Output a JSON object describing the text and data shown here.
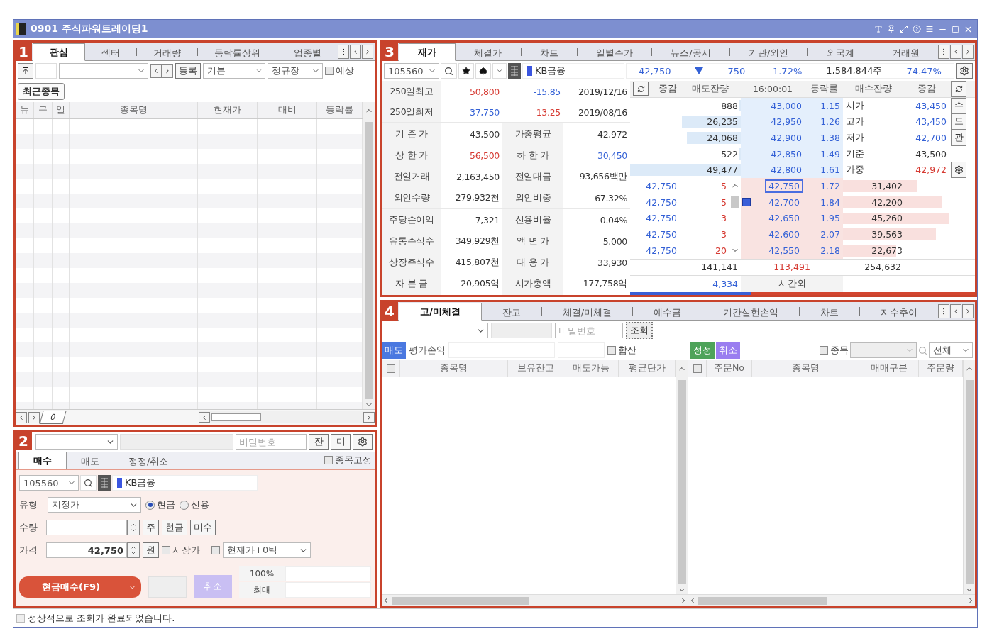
{
  "window": {
    "title": "0901 주식파워트레이딩1"
  },
  "panel1": {
    "badge": "1",
    "tabs": [
      {
        "label": "관심",
        "selected": true
      },
      {
        "label": "섹터",
        "selected": false
      },
      {
        "label": "거래량",
        "selected": false
      },
      {
        "label": "등락률상위",
        "selected": false
      },
      {
        "label": "업종별",
        "selected": false
      }
    ],
    "register_button": "등록",
    "group": "기본",
    "session": "정규장",
    "expected": {
      "label": "예상",
      "checked": false
    },
    "recent_button": "최근종목",
    "columns": [
      "뉴",
      "구",
      "일",
      "종목명",
      "현재가",
      "대비",
      "등락률"
    ],
    "sheet_tab": "0"
  },
  "panel2": {
    "badge": "2",
    "password_placeholder": "비밀번호",
    "buttons": [
      "잔",
      "미"
    ],
    "tabs": [
      {
        "label": "매수",
        "selected": true
      },
      {
        "label": "매도",
        "selected": false
      },
      {
        "label": "정정/취소",
        "selected": false
      }
    ],
    "fix_stock": {
      "label": "종목고정",
      "checked": false
    },
    "code": "105560",
    "stock_name": "KB금융",
    "type_label": "유형",
    "type_value": "지정가",
    "credit_options": [
      {
        "label": "현금",
        "selected": true
      },
      {
        "label": "신용",
        "selected": false
      }
    ],
    "qty_label": "수량",
    "qty_buttons": [
      "주",
      "현금",
      "미수"
    ],
    "price_label": "가격",
    "price_value": "42,750",
    "unit_button": "원",
    "market_price": {
      "label": "시장가",
      "checked": false
    },
    "price_mode": {
      "checked": false,
      "value": "현재가+0틱"
    },
    "order_button": "현금매수(F9)",
    "cancel_button": "취소",
    "ratio_rows": [
      "100%",
      "최대"
    ]
  },
  "panel3": {
    "badge": "3",
    "tabs": [
      {
        "label": "재가",
        "selected": true
      },
      {
        "label": "체결가",
        "selected": false
      },
      {
        "label": "차트",
        "selected": false
      },
      {
        "label": "일별주가",
        "selected": false
      },
      {
        "label": "뉴스/공시",
        "selected": false
      },
      {
        "label": "기관/외인",
        "selected": false
      },
      {
        "label": "외국계",
        "selected": false
      },
      {
        "label": "거래원",
        "selected": false
      }
    ],
    "code": "105560",
    "stock_name": "KB금융",
    "quote": {
      "price": "42,750",
      "change": "750",
      "rate": "-1.72%",
      "volume": "1,584,844주",
      "ratio": "74.47%"
    },
    "info": [
      {
        "kind": "range",
        "label": "250일최고",
        "values": [
          {
            "text": "50,800",
            "color": "#d63a32"
          },
          {
            "text": "-15.85",
            "color": "#3461d6"
          },
          {
            "text": "2019/12/16",
            "color": "#333333"
          }
        ]
      },
      {
        "kind": "range",
        "label": "250일최저",
        "values": [
          {
            "text": "37,750",
            "color": "#3461d6"
          },
          {
            "text": "13.25",
            "color": "#d63a32"
          },
          {
            "text": "2019/08/16",
            "color": "#333333"
          }
        ]
      },
      {
        "kind": "pair",
        "items": [
          {
            "label": "기 준 가",
            "value": "43,500",
            "color": "#333333"
          },
          {
            "label": "가중평균",
            "value": "42,972",
            "color": "#333333"
          }
        ]
      },
      {
        "kind": "pair",
        "items": [
          {
            "label": "상 한 가",
            "value": "56,500",
            "color": "#d63a32"
          },
          {
            "label": "하 한 가",
            "value": "30,450",
            "color": "#3461d6"
          }
        ]
      },
      {
        "kind": "pair",
        "items": [
          {
            "label": "전일거래",
            "value": "2,163,450",
            "color": "#333333"
          },
          {
            "label": "전일대금",
            "value": "93,656백만",
            "color": "#333333"
          }
        ]
      },
      {
        "kind": "pair",
        "items": [
          {
            "label": "외인수량",
            "value": "279,932천",
            "color": "#333333"
          },
          {
            "label": "외인비중",
            "value": "67.32%",
            "color": "#333333"
          }
        ]
      },
      {
        "kind": "pair",
        "items": [
          {
            "label": "주당순이익",
            "value": "7,321",
            "color": "#333333"
          },
          {
            "label": "신용비율",
            "value": "0.04%",
            "color": "#333333"
          }
        ]
      },
      {
        "kind": "pair",
        "items": [
          {
            "label": "유통주식수",
            "value": "349,929천",
            "color": "#333333"
          },
          {
            "label": "액 면 가",
            "value": "5,000",
            "color": "#333333"
          }
        ]
      },
      {
        "kind": "pair",
        "items": [
          {
            "label": "상장주식수",
            "value": "415,807천",
            "color": "#333333"
          },
          {
            "label": "대 용 가",
            "value": "33,930",
            "color": "#333333"
          }
        ]
      },
      {
        "kind": "pair",
        "items": [
          {
            "label": "자 본 금",
            "value": "20,905억",
            "color": "#333333"
          },
          {
            "label": "시가총액",
            "value": "177,758억",
            "color": "#333333"
          }
        ]
      }
    ],
    "book_header": [
      "증감",
      "매도잔량",
      "16:00:01",
      "등락률",
      "매수잔량",
      "증감"
    ],
    "asks": [
      {
        "qty": "888",
        "level": 0.02,
        "price": "43,000",
        "rate": "1.15"
      },
      {
        "qty": "26,235",
        "level": 0.53,
        "price": "42,950",
        "rate": "1.26"
      },
      {
        "qty": "24,068",
        "level": 0.49,
        "price": "42,900",
        "rate": "1.38"
      },
      {
        "qty": "522",
        "level": 0.01,
        "price": "42,850",
        "rate": "1.49"
      },
      {
        "qty": "49,477",
        "level": 1.0,
        "price": "42,800",
        "rate": "1.61"
      }
    ],
    "summary": [
      {
        "label": "시가",
        "value": "43,450",
        "color": "#3461d6"
      },
      {
        "label": "고가",
        "value": "43,450",
        "color": "#3461d6"
      },
      {
        "label": "저가",
        "value": "42,700",
        "color": "#3461d6"
      },
      {
        "label": "기준",
        "value": "43,500",
        "color": "#333333"
      },
      {
        "label": "가중",
        "value": "42,972",
        "color": "#d63a32"
      }
    ],
    "side_buttons": [
      "수",
      "도",
      "관"
    ],
    "bids": [
      {
        "tick_price": "42,750",
        "tick_qty": "5",
        "price": "42,750",
        "rate": "1.72",
        "qty": "31,402",
        "level": 0.69,
        "selected": true,
        "low_mark": false
      },
      {
        "tick_price": "42,750",
        "tick_qty": "5",
        "price": "42,700",
        "rate": "1.84",
        "qty": "42,200",
        "level": 0.93,
        "selected": false,
        "low_mark": true
      },
      {
        "tick_price": "42,750",
        "tick_qty": "3",
        "price": "42,650",
        "rate": "1.95",
        "qty": "45,260",
        "level": 1.0,
        "selected": false,
        "low_mark": false
      },
      {
        "tick_price": "42,750",
        "tick_qty": "3",
        "price": "42,600",
        "rate": "2.07",
        "qty": "39,563",
        "level": 0.87,
        "selected": false,
        "low_mark": false
      },
      {
        "tick_price": "42,750",
        "tick_qty": "20",
        "price": "42,550",
        "rate": "2.18",
        "qty": "22,673",
        "level": 0.5,
        "selected": false,
        "low_mark": false
      }
    ],
    "totals": {
      "ask": "141,141",
      "diff": "113,491",
      "bid": "254,632"
    },
    "after_hours": {
      "qty": "4,334",
      "label": "시간외"
    },
    "strength": {
      "level": 0.35
    }
  },
  "panel4": {
    "badge": "4",
    "tabs": [
      {
        "label": "고/미체결",
        "selected": true
      },
      {
        "label": "잔고",
        "selected": false
      },
      {
        "label": "체결/미체결",
        "selected": false
      },
      {
        "label": "예수금",
        "selected": false
      },
      {
        "label": "기간실현손익",
        "selected": false
      },
      {
        "label": "차트",
        "selected": false
      },
      {
        "label": "지수추이",
        "selected": false
      }
    ],
    "password_placeholder": "비밀번호",
    "query_button": "조회",
    "sell_button": "매도",
    "pnl_label": "평가손익",
    "sum": {
      "label": "합산",
      "checked": false
    },
    "left_table": {
      "select_all": {
        "checked": false
      },
      "columns": [
        "종목명",
        "보유잔고",
        "매도가능",
        "평균단가"
      ]
    },
    "modify_button": "정정",
    "cancel_button": "취소",
    "stock_filter": {
      "label": "종목",
      "checked": false
    },
    "scope": "전체",
    "right_table": {
      "select_all": {
        "checked": false
      },
      "columns": [
        "주문No",
        "종목명",
        "매매구분",
        "주문량"
      ]
    }
  },
  "status_bar": "정상적으로 조회가 완료되었습니다."
}
